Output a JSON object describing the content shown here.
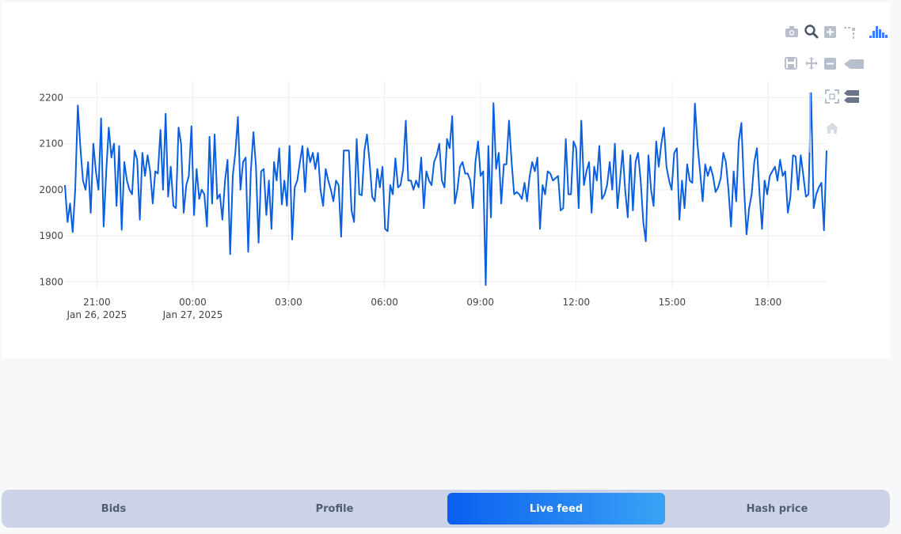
{
  "chart_data": {
    "type": "line",
    "title": "",
    "xlabel": "",
    "ylabel": "",
    "ylim": [
      1785,
      2235
    ],
    "grid": true,
    "x_start": "2025-01-26T20:00",
    "x_end": "2025-01-27T19:50",
    "x_tick_labels": [
      {
        "time": "21:00",
        "date": "Jan 26, 2025"
      },
      {
        "time": "00:00",
        "date": "Jan 27, 2025"
      },
      {
        "time": "03:00",
        "date": ""
      },
      {
        "time": "06:00",
        "date": ""
      },
      {
        "time": "09:00",
        "date": ""
      },
      {
        "time": "12:00",
        "date": ""
      },
      {
        "time": "15:00",
        "date": ""
      },
      {
        "time": "18:00",
        "date": ""
      }
    ],
    "y_ticks": [
      1800,
      1900,
      2000,
      2100,
      2200
    ],
    "line_color": "#0a5fe0",
    "series": [
      {
        "values": [
          2010,
          1930,
          1970,
          1908,
          2000,
          2183,
          2090,
          2020,
          2000,
          2060,
          1950,
          2100,
          2040,
          2000,
          2155,
          1920,
          2040,
          2135,
          2070,
          2100,
          1965,
          2095,
          1913,
          2060,
          2020,
          2000,
          1990,
          2085,
          2065,
          1935,
          2080,
          2030,
          2075,
          2040,
          1970,
          2040,
          2035,
          2130,
          2000,
          2165,
          1985,
          2050,
          1965,
          1960,
          2135,
          2100,
          1950,
          2010,
          2030,
          2138,
          1945,
          2045,
          1980,
          2000,
          1990,
          1920,
          2115,
          1970,
          2120,
          1980,
          1990,
          1935,
          2020,
          2065,
          1860,
          2030,
          2080,
          2158,
          2000,
          2060,
          2070,
          1865,
          2040,
          2125,
          2050,
          1885,
          2040,
          2045,
          1945,
          2020,
          1915,
          2060,
          2020,
          2090,
          1968,
          2020,
          1965,
          2095,
          1892,
          2005,
          2020,
          2060,
          2095,
          1995,
          2090,
          2060,
          2080,
          2045,
          2080,
          2000,
          1965,
          2045,
          2020,
          2000,
          1975,
          2020,
          2010,
          1898,
          2085,
          2085,
          2085,
          1955,
          1930,
          2110,
          1990,
          1988,
          2085,
          2120,
          2060,
          1985,
          1975,
          2045,
          2005,
          2050,
          1915,
          1910,
          2010,
          1990,
          2068,
          2005,
          2010,
          2045,
          2150,
          2020,
          2020,
          2000,
          2020,
          2005,
          2070,
          1960,
          2040,
          2020,
          2010,
          2060,
          2075,
          2100,
          2020,
          2005,
          2110,
          2090,
          2160,
          1970,
          2000,
          2050,
          2060,
          2035,
          2035,
          2020,
          1960,
          2060,
          2105,
          2030,
          2040,
          1793,
          2095,
          1940,
          2188,
          2045,
          2080,
          1970,
          2055,
          2055,
          2150,
          2060,
          1990,
          1995,
          1990,
          1980,
          2015,
          1975,
          2030,
          2060,
          2040,
          2070,
          1915,
          2010,
          1990,
          2040,
          2035,
          2020,
          2025,
          2030,
          1955,
          1960,
          2110,
          1990,
          1990,
          2105,
          2090,
          1960,
          2150,
          2010,
          2040,
          2060,
          1950,
          2050,
          2020,
          2095,
          1980,
          1990,
          2010,
          2060,
          2000,
          2100,
          1960,
          2020,
          2085,
          2000,
          1940,
          2075,
          1955,
          2060,
          2080,
          2020,
          1930,
          1888,
          2075,
          2000,
          1965,
          2105,
          2050,
          2100,
          2135,
          2050,
          2020,
          2000,
          2080,
          2090,
          1935,
          2020,
          1960,
          2055,
          2020,
          2015,
          2187,
          2100,
          2040,
          1975,
          2055,
          2030,
          2050,
          2030,
          1995,
          2005,
          2025,
          2080,
          2060,
          2000,
          1920,
          2040,
          1975,
          2105,
          2145,
          2010,
          1903,
          1960,
          1990,
          2060,
          2090,
          1995,
          1915,
          2020,
          1990,
          2030,
          2040,
          2050,
          2020,
          2065,
          2030,
          2040,
          1950,
          1985,
          2075,
          2072,
          2000,
          2075,
          2030,
          1985,
          1990,
          2210,
          1960,
          1990,
          2005,
          2015,
          1912,
          2085
        ]
      }
    ]
  },
  "modebar": {
    "icons": [
      "camera-icon",
      "zoom-icon",
      "zoom-in-icon",
      "spikeline-icon",
      "bar-chart-icon",
      "save-icon",
      "pan-icon",
      "zoom-out-icon",
      "hover-closest-icon",
      "autoscale-icon",
      "hover-compare-icon",
      "reset-axes-icon"
    ]
  },
  "tabs": [
    {
      "label": "Bids",
      "active": false
    },
    {
      "label": "Profile",
      "active": false
    },
    {
      "label": "Live feed",
      "active": true
    },
    {
      "label": "Hash price",
      "active": false
    }
  ]
}
